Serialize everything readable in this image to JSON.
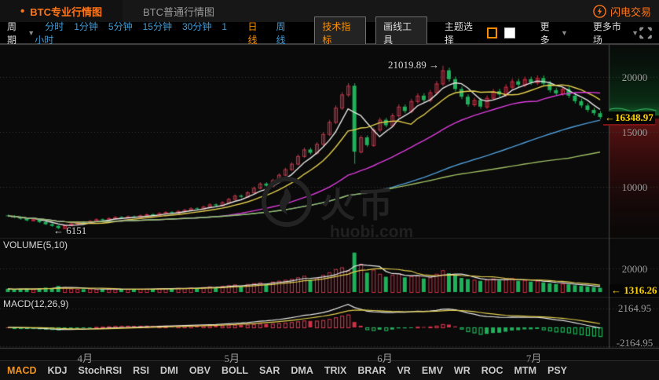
{
  "tabs": {
    "pro": "BTC专业行情图",
    "normal": "BTC普通行情图",
    "flash_trade": "闪电交易"
  },
  "toolbar": {
    "period_label": "周期",
    "periods": [
      "分时",
      "1分钟",
      "5分钟",
      "15分钟",
      "30分钟",
      "1小时"
    ],
    "day_line": "日线",
    "week_line": "周线",
    "tech_indicator": "技术指标",
    "draw_tool": "画线工具",
    "theme_label": "主题选择",
    "more": "更多",
    "more_markets": "更多市场"
  },
  "chart": {
    "volume_label": "VOLUME(5,10)",
    "macd_label": "MACD(12,26,9)",
    "axis": {
      "p1": "20000",
      "p2": "15000",
      "p3": "10000",
      "price_tag": "←16348.97",
      "v1": "20000",
      "v_tag": "← 1316.26",
      "m1": "2164.95",
      "m2": "-2164.95"
    },
    "annotations": {
      "high": "21019.89 →",
      "low": "← 6151"
    },
    "watermark": {
      "cn": "火币",
      "url": "huobi.com"
    }
  },
  "footer": {
    "indicators": [
      "MACD",
      "KDJ",
      "StochRSI",
      "RSI",
      "DMI",
      "OBV",
      "BOLL",
      "SAR",
      "DMA",
      "TRIX",
      "BRAR",
      "VR",
      "EMV",
      "WR",
      "ROC",
      "MTM",
      "PSY"
    ],
    "active": "MACD"
  },
  "colors": {
    "accent": "#ff7519",
    "link_blue": "#3d9ddb",
    "active_orange": "#ff9000",
    "candle_up": "#cf3045",
    "candle_down": "#1fb15a",
    "ma_colors": [
      "#e6e6e6",
      "#e3cf4e",
      "#dd3ddd",
      "#4f9ed9",
      "#9dbd62"
    ],
    "price_tag": "#ffd400",
    "grid": "#3d3d3d",
    "axis_line": "#4a4a4a"
  },
  "chart_data": {
    "type": "candlestick",
    "interval": "daily",
    "title": "BTC/CNY Huobi daily chart, April - July",
    "months": [
      {
        "label": "4月",
        "fx": 0.129
      },
      {
        "label": "5月",
        "fx": 0.352
      },
      {
        "label": "6月",
        "fx": 0.584
      },
      {
        "label": "7月",
        "fx": 0.81
      }
    ],
    "price_gridlines": [
      20000,
      15000,
      10000
    ],
    "price_high": 21019.89,
    "price_low": 6151,
    "last_price": 16348.97,
    "last_volume": 1316.26,
    "volume_gridline": 20000,
    "macd_gridline": 2164.95,
    "ma_windows": [
      5,
      10,
      30,
      60,
      90
    ],
    "volume_ma_windows": [
      5,
      10
    ],
    "macd_params": [
      12,
      26,
      9
    ],
    "first_open": 7400,
    "wick_pct": 0.012,
    "closes": [
      7350,
      7250,
      7100,
      6950,
      7050,
      6800,
      6600,
      6450,
      6250,
      6500,
      6650,
      6800,
      6750,
      6900,
      7050,
      7000,
      7150,
      7250,
      7200,
      7300,
      7250,
      7400,
      7500,
      7450,
      7600,
      7700,
      7650,
      7800,
      7900,
      8050,
      8000,
      8200,
      8400,
      8300,
      8600,
      8900,
      9200,
      9100,
      9500,
      9900,
      10300,
      10100,
      10600,
      11100,
      11600,
      12100,
      12800,
      13400,
      13100,
      13900,
      14800,
      15900,
      17200,
      18400,
      19200,
      13200,
      14500,
      13800,
      15200,
      16100,
      15600,
      16500,
      17300,
      16900,
      17800,
      18300,
      17900,
      18600,
      19400,
      20600,
      19800,
      18900,
      18200,
      17500,
      17900,
      17300,
      18100,
      18700,
      18400,
      19100,
      19600,
      19300,
      19800,
      19500,
      19900,
      19400,
      18800,
      18500,
      18900,
      18300,
      17800,
      17400,
      17000,
      16700,
      16348.97
    ],
    "wick_overrides": {
      "8": {
        "l": 6151
      },
      "55": {
        "l": 12100
      },
      "69": {
        "h": 21019.89
      }
    },
    "volumes": [
      2800,
      2200,
      2600,
      3000,
      2400,
      3200,
      3800,
      3500,
      5200,
      4200,
      3000,
      2600,
      2400,
      2800,
      2500,
      2200,
      2600,
      2400,
      2100,
      2500,
      2300,
      2700,
      2900,
      2500,
      3100,
      3300,
      2800,
      3500,
      3200,
      3800,
      3400,
      4200,
      4800,
      3900,
      5200,
      5800,
      6400,
      4900,
      6800,
      7500,
      8200,
      6800,
      8800,
      9600,
      10400,
      11200,
      12500,
      13800,
      10500,
      12200,
      14500,
      16800,
      19500,
      21000,
      18500,
      33500,
      24000,
      16500,
      19000,
      15500,
      13000,
      14500,
      16000,
      12500,
      13500,
      14000,
      11500,
      12500,
      15500,
      18500,
      16000,
      14000,
      12000,
      11000,
      10500,
      9500,
      10500,
      11500,
      9800,
      10800,
      11800,
      9500,
      10200,
      8800,
      9600,
      8200,
      7500,
      6800,
      7200,
      6500,
      5800,
      5200,
      4800,
      4200,
      3600
    ]
  }
}
